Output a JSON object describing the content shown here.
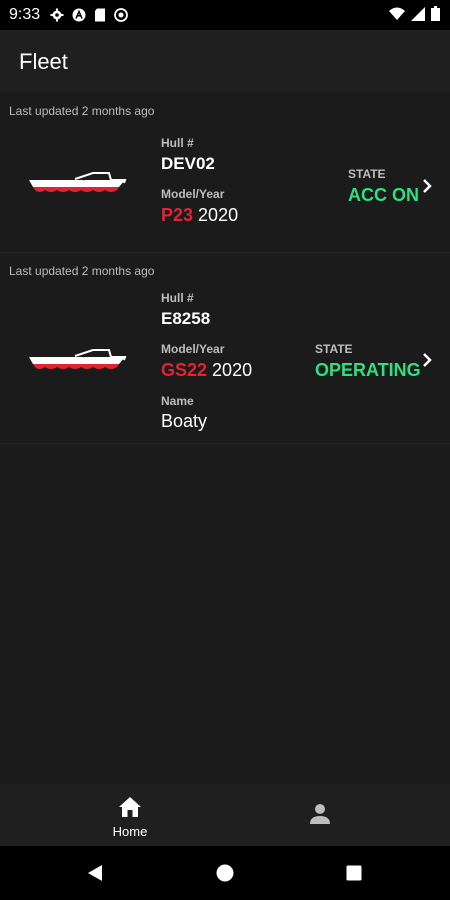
{
  "status_bar": {
    "time": "9:33",
    "left_icons": [
      "gear-icon",
      "a-circle-icon",
      "sd-card-icon",
      "sync-icon"
    ],
    "right_icons": [
      "wifi-icon",
      "cell-signal-icon",
      "battery-icon"
    ]
  },
  "header": {
    "title": "Fleet"
  },
  "vessels": [
    {
      "last_updated": "Last updated 2 months ago",
      "hull_label": "Hull #",
      "hull": "DEV02",
      "model_year_label": "Model/Year",
      "model": "P23",
      "year": "2020",
      "state_label": "STATE",
      "state": "ACC ON"
    },
    {
      "last_updated": "Last updated 2 months ago",
      "hull_label": "Hull #",
      "hull": "E8258",
      "model_year_label": "Model/Year",
      "model": "GS22",
      "year": "2020",
      "name_label": "Name",
      "name": "Boaty",
      "state_label": "STATE",
      "state": "OPERATING"
    }
  ],
  "bottom_nav": {
    "items": [
      {
        "label": "Home",
        "icon": "home-icon",
        "active": true
      },
      {
        "label": "",
        "icon": "person-icon",
        "active": false
      }
    ]
  },
  "system_nav": {
    "icons": [
      "back-icon",
      "home-circle-icon",
      "recents-icon"
    ]
  },
  "colors": {
    "background": "#1c1c1c",
    "model_red": "#e02434",
    "state_green": "#2ee07e",
    "status_bar": "#000000"
  }
}
